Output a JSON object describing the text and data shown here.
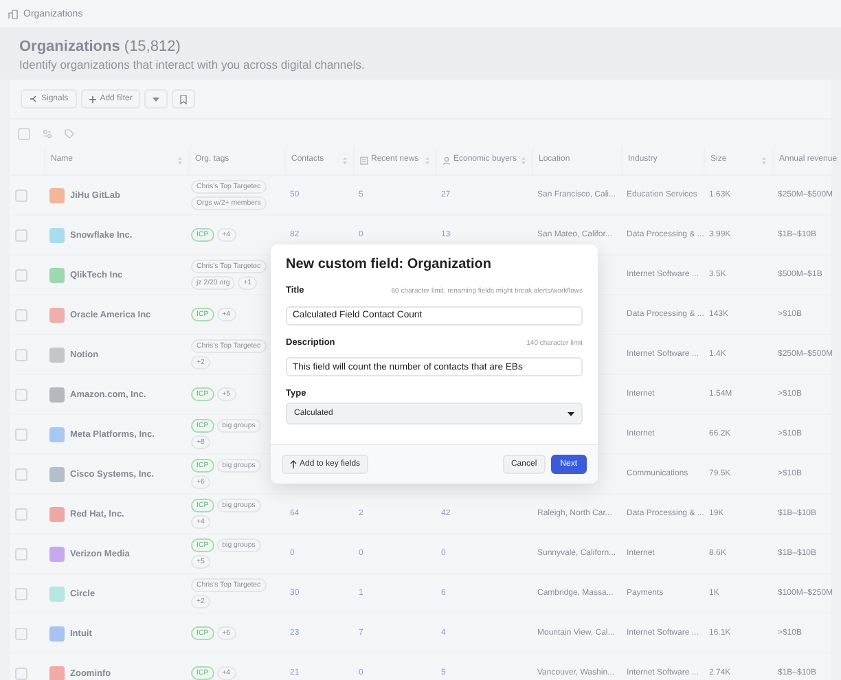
{
  "topbar": {
    "title": "Organizations"
  },
  "header": {
    "title": "Organizations",
    "count": "(15,812)",
    "subtitle": "Identify organizations that interact with you across digital channels."
  },
  "toolbar": {
    "signals": "Signals",
    "add_filter": "Add filter"
  },
  "select_all": {
    "checked": false
  },
  "table": {
    "columns": [
      {
        "label": "Name",
        "sortable": true
      },
      {
        "label": "Org. tags",
        "sortable": false
      },
      {
        "label": "Contacts",
        "sortable": true
      },
      {
        "label": "Recent news",
        "sortable": true
      },
      {
        "label": "Economic buyers",
        "sortable": true
      },
      {
        "label": "Location",
        "sortable": false
      },
      {
        "label": "Industry",
        "sortable": false
      },
      {
        "label": "Size",
        "sortable": true
      },
      {
        "label": "Annual revenue",
        "sortable": false
      }
    ],
    "rows": [
      {
        "checked": false,
        "name": "JiHu GitLab",
        "color": "#f0b79a",
        "tags": [
          {
            "kind": "plain",
            "label": "Chris's Top Targetec"
          },
          {
            "kind": "plain",
            "label": "Orgs w/2+ members"
          }
        ],
        "contacts": "50",
        "news": "5",
        "buyers": "27",
        "location": "San Francisco, Cali...",
        "industry": "Education Services",
        "size": "1.63K",
        "revenue": "$250M–$500M"
      },
      {
        "checked": false,
        "name": "Snowflake Inc.",
        "color": "#a9dcef",
        "tags": [
          {
            "kind": "icp",
            "label": "ICP"
          },
          {
            "kind": "plain",
            "label": "+4"
          }
        ],
        "contacts": "82",
        "news": "0",
        "buyers": "13",
        "location": "San Mateo, Califor...",
        "industry": "Data Processing & ...",
        "size": "3.99K",
        "revenue": "$1B–$10B"
      },
      {
        "checked": false,
        "name": "QlikTech Inc",
        "color": "#9fd8ae",
        "tags": [
          {
            "kind": "plain",
            "label": "Chris's Top Targetec"
          },
          {
            "kind": "plain",
            "label": "jz 2/20 org"
          },
          {
            "kind": "plain",
            "label": "+1"
          }
        ],
        "industry": "Internet Software ...",
        "size": "3.5K",
        "revenue": "$500M–$1B"
      },
      {
        "checked": false,
        "name": "Oracle America Inc",
        "color": "#eeb0aa",
        "tags": [
          {
            "kind": "icp",
            "label": "ICP"
          },
          {
            "kind": "plain",
            "label": "+4"
          }
        ],
        "industry": "Data Processing & ...",
        "size": "143K",
        "revenue": ">$10B"
      },
      {
        "checked": false,
        "name": "Notion",
        "color": "#c4c6ca",
        "tags": [
          {
            "kind": "plain",
            "label": "Chris's Top Targetec"
          },
          {
            "kind": "plain",
            "label": "+2"
          }
        ],
        "industry": "Internet Software ...",
        "size": "1.4K",
        "revenue": "$250M–$500M"
      },
      {
        "checked": false,
        "name": "Amazon.com, Inc.",
        "color": "#b5b8bc",
        "tags": [
          {
            "kind": "icp",
            "label": "ICP"
          },
          {
            "kind": "plain",
            "label": "+5"
          }
        ],
        "industry": "Internet",
        "size": "1.54M",
        "revenue": ">$10B"
      },
      {
        "checked": false,
        "name": "Meta Platforms, Inc.",
        "color": "#a9c7f3",
        "tags": [
          {
            "kind": "icp",
            "label": "ICP"
          },
          {
            "kind": "plain",
            "label": "big groups"
          },
          {
            "kind": "plain",
            "label": "+8"
          }
        ],
        "industry": "Internet",
        "size": "66.2K",
        "revenue": ">$10B"
      },
      {
        "checked": false,
        "name": "Cisco Systems, Inc.",
        "color": "#b4bfcb",
        "tags": [
          {
            "kind": "icp",
            "label": "ICP"
          },
          {
            "kind": "plain",
            "label": "big groups"
          },
          {
            "kind": "plain",
            "label": "+6"
          }
        ],
        "industry": "Communications",
        "size": "79.5K",
        "revenue": ">$10B"
      },
      {
        "checked": false,
        "name": "Red Hat, Inc.",
        "color": "#eea8a4",
        "tags": [
          {
            "kind": "icp",
            "label": "ICP"
          },
          {
            "kind": "plain",
            "label": "big groups"
          },
          {
            "kind": "plain",
            "label": "+4"
          }
        ],
        "contacts": "64",
        "news": "2",
        "buyers": "42",
        "location": "Raleigh, North Car...",
        "industry": "Data Processing & ...",
        "size": "19K",
        "revenue": "$1B–$10B"
      },
      {
        "checked": false,
        "name": "Verizon Media",
        "color": "#c7a8ee",
        "tags": [
          {
            "kind": "icp",
            "label": "ICP"
          },
          {
            "kind": "plain",
            "label": "big groups"
          },
          {
            "kind": "plain",
            "label": "+5"
          }
        ],
        "contacts": "0",
        "news": "0",
        "buyers": "0",
        "location": "Sunnyvale, Californ...",
        "industry": "Internet",
        "size": "8.6K",
        "revenue": "$1B–$10B"
      },
      {
        "checked": false,
        "name": "Circle",
        "color": "#b6e6e2",
        "tags": [
          {
            "kind": "plain",
            "label": "Chris's Top Targetec"
          },
          {
            "kind": "plain",
            "label": "+2"
          }
        ],
        "contacts": "30",
        "news": "1",
        "buyers": "6",
        "location": "Cambridge, Massa...",
        "industry": "Payments",
        "size": "1K",
        "revenue": "$100M–$250M"
      },
      {
        "checked": false,
        "name": "Intuit",
        "color": "#a9c3f0",
        "tags": [
          {
            "kind": "icp",
            "label": "ICP"
          },
          {
            "kind": "plain",
            "label": "+6"
          }
        ],
        "contacts": "23",
        "news": "7",
        "buyers": "4",
        "location": "Mountain View, Cal...",
        "industry": "Internet Software ...",
        "size": "16.1K",
        "revenue": ">$10B"
      },
      {
        "checked": false,
        "name": "Zoominfo",
        "color": "#f2aaa6",
        "tags": [
          {
            "kind": "icp",
            "label": "ICP"
          },
          {
            "kind": "plain",
            "label": "+4"
          }
        ],
        "contacts": "21",
        "news": "0",
        "buyers": "5",
        "location": "Vancouver, Washin...",
        "industry": "Internet Software ...",
        "size": "2.74K",
        "revenue": "$1B–$10B"
      }
    ]
  },
  "dialog": {
    "title": "New custom field: Organization",
    "fields": [
      {
        "label": "Title",
        "hint": "60 character limit, renaming fields might break alerts/workflows",
        "kind": "text",
        "value": "Calculated Field Contact Count"
      },
      {
        "label": "Description",
        "hint": "140 character limit",
        "kind": "text",
        "value": "This field will count the number of contacts that are EBs"
      },
      {
        "label": "Type",
        "kind": "select",
        "value": "Calculated"
      }
    ],
    "buttons": [
      {
        "kind": "secondary",
        "label": "Add to key fields"
      },
      {
        "kind": "neutral",
        "label": "Cancel"
      },
      {
        "kind": "primary",
        "label": "Next"
      }
    ]
  }
}
